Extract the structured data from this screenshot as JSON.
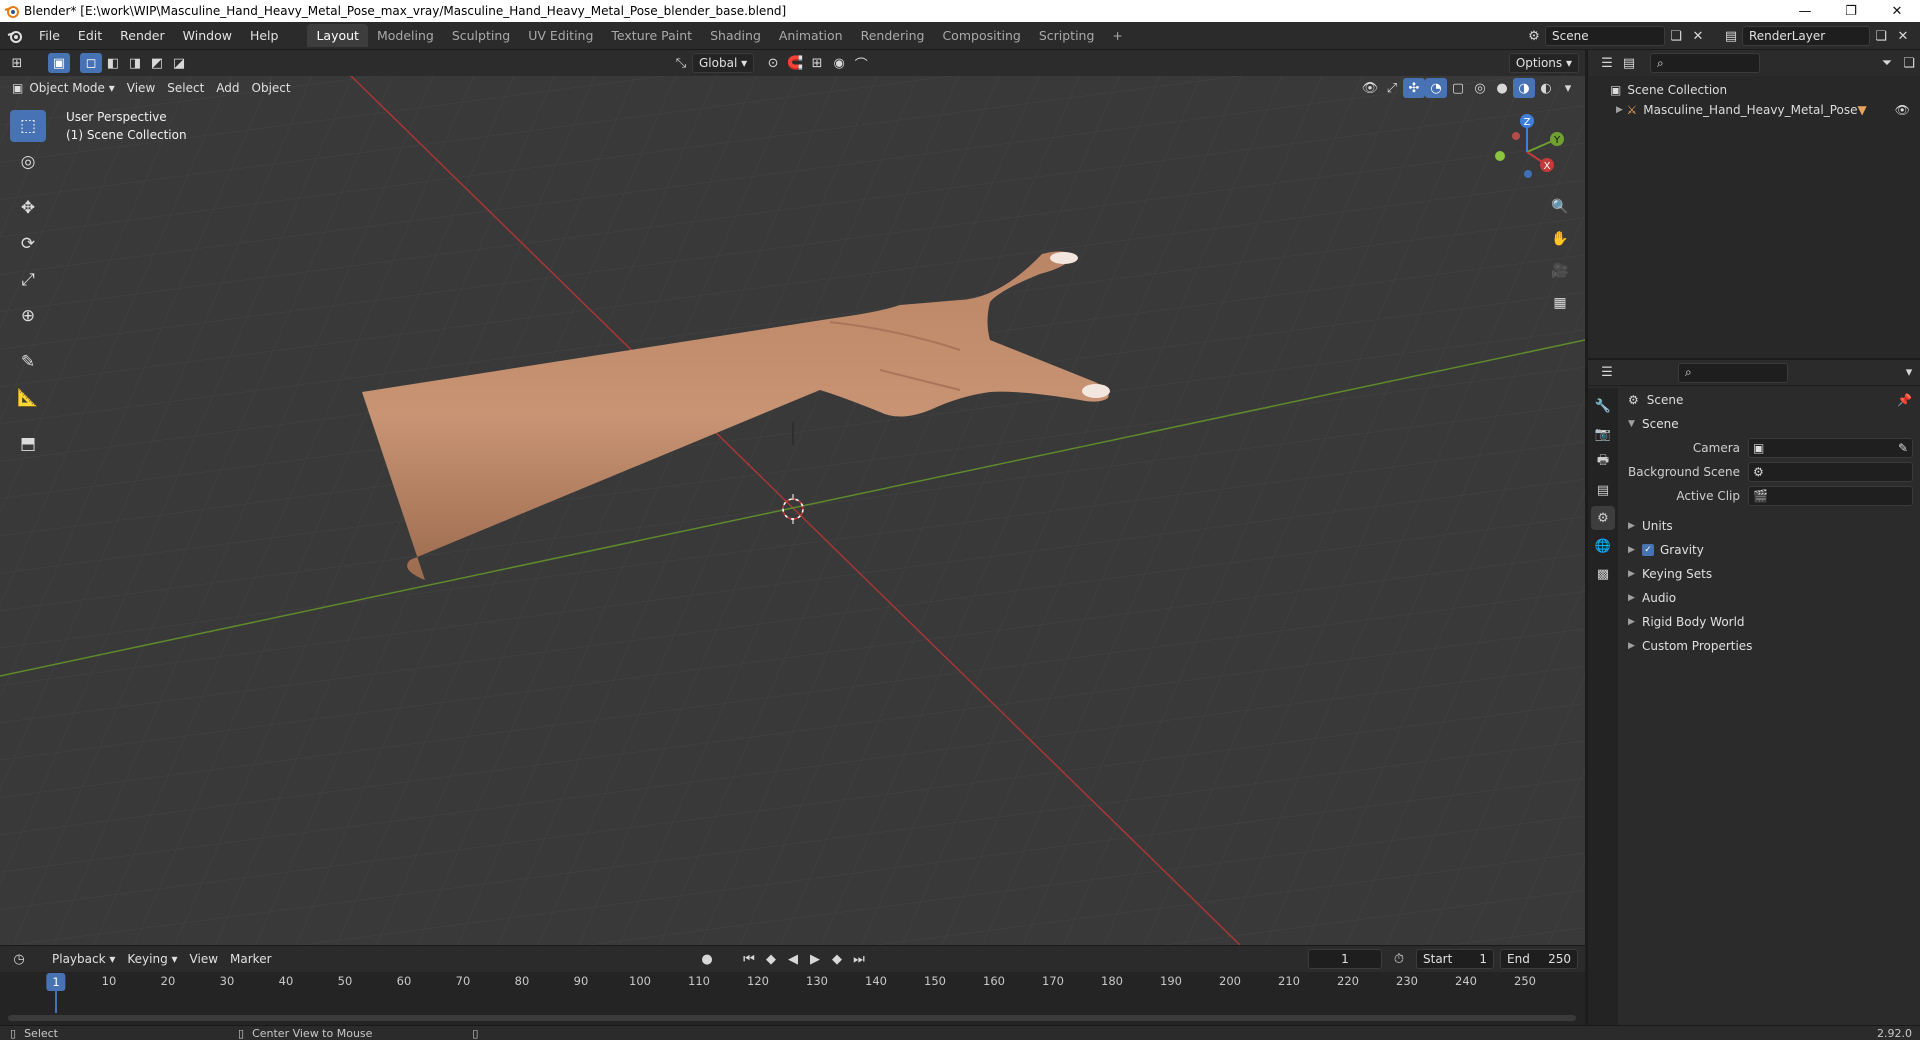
{
  "window": {
    "title": "Blender* [E:\\work\\WIP\\Masculine_Hand_Heavy_Metal_Pose_max_vray/Masculine_Hand_Heavy_Metal_Pose_blender_base.blend]",
    "minimize": "—",
    "maximize": "❐",
    "close": "✕"
  },
  "menu": [
    "File",
    "Edit",
    "Render",
    "Window",
    "Help"
  ],
  "workspaces": [
    "Layout",
    "Modeling",
    "Sculpting",
    "UV Editing",
    "Texture Paint",
    "Shading",
    "Animation",
    "Rendering",
    "Compositing",
    "Scripting"
  ],
  "add_workspace": "+",
  "scene_selector": {
    "value": "Scene"
  },
  "render_layer": {
    "value": "RenderLayer"
  },
  "viewport": {
    "mode": "Object Mode",
    "menus": [
      "View",
      "Select",
      "Add",
      "Object"
    ],
    "transform_orientation": "Global",
    "options": "Options",
    "view_name": "User Perspective",
    "collection_label": "(1) Scene Collection",
    "gizmo_axes": {
      "x": "X",
      "y": "Y",
      "z": "Z"
    }
  },
  "outliner": {
    "root": "Scene Collection",
    "object": "Masculine_Hand_Heavy_Metal_Pose"
  },
  "properties": {
    "title": "Scene",
    "section": "Scene",
    "fields": [
      {
        "label": "Camera",
        "value": ""
      },
      {
        "label": "Background Scene",
        "value": ""
      },
      {
        "label": "Active Clip",
        "value": ""
      }
    ],
    "panels": [
      {
        "label": "Units",
        "checkbox": false
      },
      {
        "label": "Gravity",
        "checkbox": true
      },
      {
        "label": "Keying Sets",
        "checkbox": false
      },
      {
        "label": "Audio",
        "checkbox": false
      },
      {
        "label": "Rigid Body World",
        "checkbox": false
      },
      {
        "label": "Custom Properties",
        "checkbox": false
      }
    ]
  },
  "timeline": {
    "menus": [
      "Playback",
      "Keying",
      "View",
      "Marker"
    ],
    "current_frame": "1",
    "start_label": "Start",
    "start": "1",
    "end_label": "End",
    "end": "250",
    "ruler": [
      "1",
      "10",
      "20",
      "30",
      "40",
      "50",
      "60",
      "70",
      "80",
      "90",
      "100",
      "110",
      "120",
      "130",
      "140",
      "150",
      "160",
      "170",
      "180",
      "190",
      "200",
      "210",
      "220",
      "230",
      "240",
      "250"
    ]
  },
  "status": {
    "select": "Select",
    "center_view": "Center View to Mouse",
    "version": "2.92.0"
  },
  "colors": {
    "accent": "#4772b3",
    "x_axis": "#c23b3b",
    "y_axis": "#6fa031",
    "skin": "#c58f6c"
  }
}
